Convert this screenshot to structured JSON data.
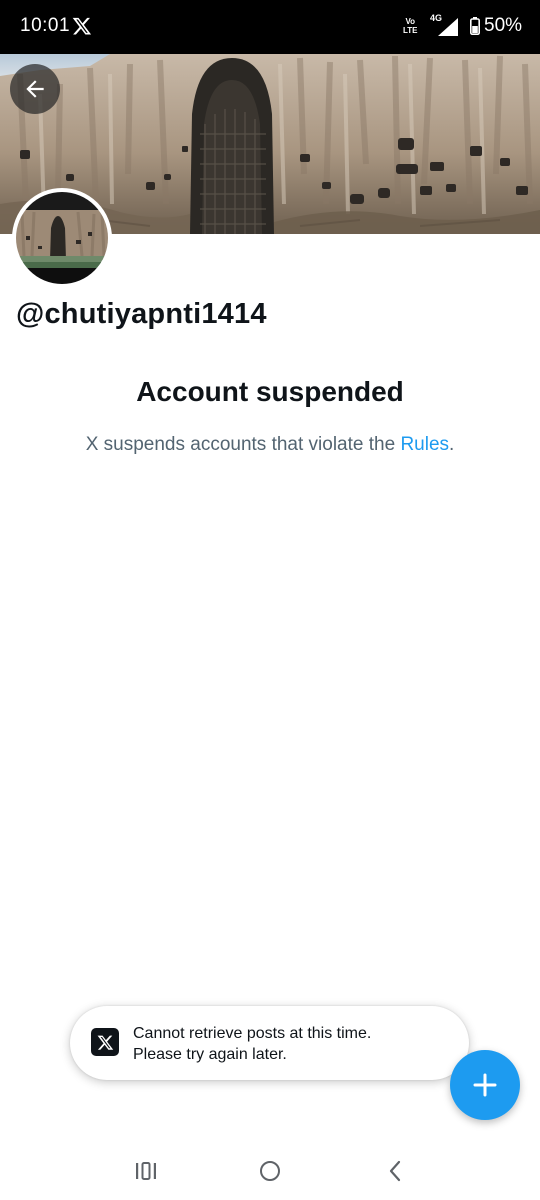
{
  "status_bar": {
    "time": "10:01",
    "volte_line1": "Vo",
    "volte_line2": "LTE",
    "network": "4G",
    "battery": "50%",
    "icons": [
      "x-logo-icon",
      "signal-icon",
      "battery-icon"
    ]
  },
  "profile": {
    "handle": "@chutiyapnti1414",
    "banner_image": "cliff-niche-banner",
    "avatar_image": "cliff-niche-avatar"
  },
  "suspension": {
    "title": "Account suspended",
    "description_prefix": "X suspends accounts that violate the ",
    "rules_link": "Rules",
    "description_suffix": "."
  },
  "toast": {
    "line1": "Cannot retrieve posts at this time.",
    "line2": "Please try again later.",
    "icon": "x-logo-icon"
  },
  "fab": {
    "icon": "plus-icon"
  },
  "nav_bar": {
    "icons": [
      "recent-apps-icon",
      "home-icon",
      "back-icon"
    ]
  },
  "colors": {
    "accent": "#1d9bf0",
    "text_primary": "#0f1419",
    "text_secondary": "#536471",
    "status_bar_bg": "#000000"
  }
}
